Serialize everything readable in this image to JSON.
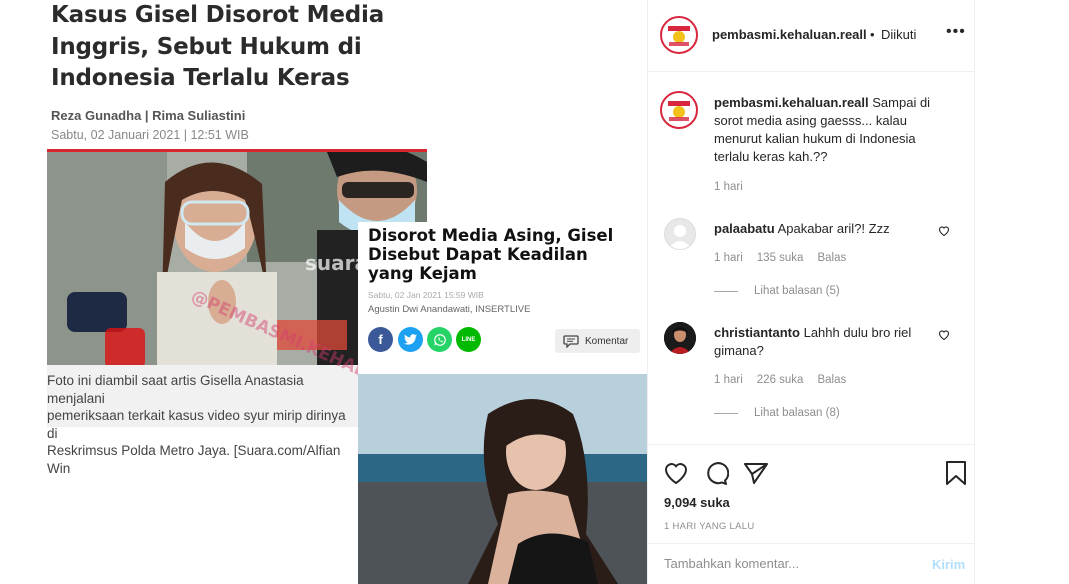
{
  "news1": {
    "headline": "Kasus Gisel Disorot Media Inggris, Sebut Hukum di Indonesia Terlalu Keras",
    "authors": "Reza Gunadha | Rima Suliastini",
    "date": "Sabtu, 02 Januari 2021 | 12:51 WIB",
    "watermark": "suara.",
    "caption": "Foto ini diambil saat artis Gisella Anastasia menjalani\npemeriksaan terkait kasus video syur mirip dirinya di\nReskrimsus Polda Metro Jaya. [Suara.com/Alfian Win",
    "overlay_watermark": "@PEMBASMI.KEHALUAN.REAL"
  },
  "news2": {
    "headline": "Disorot Media Asing, Gisel Disebut Dapat Keadilan yang Kejam",
    "meta": "Sabtu, 02 Jan 2021 15:59 WIB",
    "author": "Agustin Dwi Anandawati, INSERTLIVE",
    "comment_button": "Komentar",
    "share_icons": [
      "facebook-icon",
      "twitter-icon",
      "whatsapp-icon",
      "line-icon"
    ]
  },
  "header": {
    "username": "pembasmi.kehaluan.reall",
    "separator": "•",
    "follow_status": "Diikuti",
    "more_icon": "more-icon"
  },
  "caption": {
    "username": "pembasmi.kehaluan.reall",
    "text": "Sampai di sorot media asing gaesss... kalau menurut kalian hukum di Indonesia terlalu keras kah.??",
    "time": "1 hari"
  },
  "comments": [
    {
      "username": "palaabatu",
      "text": "Apakabar aril?! Zzz",
      "time": "1 hari",
      "likes": "135 suka",
      "reply": "Balas",
      "view_replies": "Lihat balasan (5)"
    },
    {
      "username": "christiantanto",
      "text": "Lahhh dulu bro riel gimana?",
      "time": "1 hari",
      "likes": "226 suka",
      "reply": "Balas",
      "view_replies": "Lihat balasan (8)"
    }
  ],
  "actions": {
    "likes": "9,094 suka",
    "posted": "1 HARI YANG LALU",
    "icons": [
      "heart-icon",
      "comment-icon",
      "share-icon",
      "bookmark-icon"
    ]
  },
  "add_comment": {
    "placeholder": "Tambahkan komentar...",
    "send": "Kirim"
  },
  "colors": {
    "accent_red": "#d8262c",
    "instagram_blue_disabled": "#b2dffc",
    "muted_text": "#8e8e8e"
  }
}
